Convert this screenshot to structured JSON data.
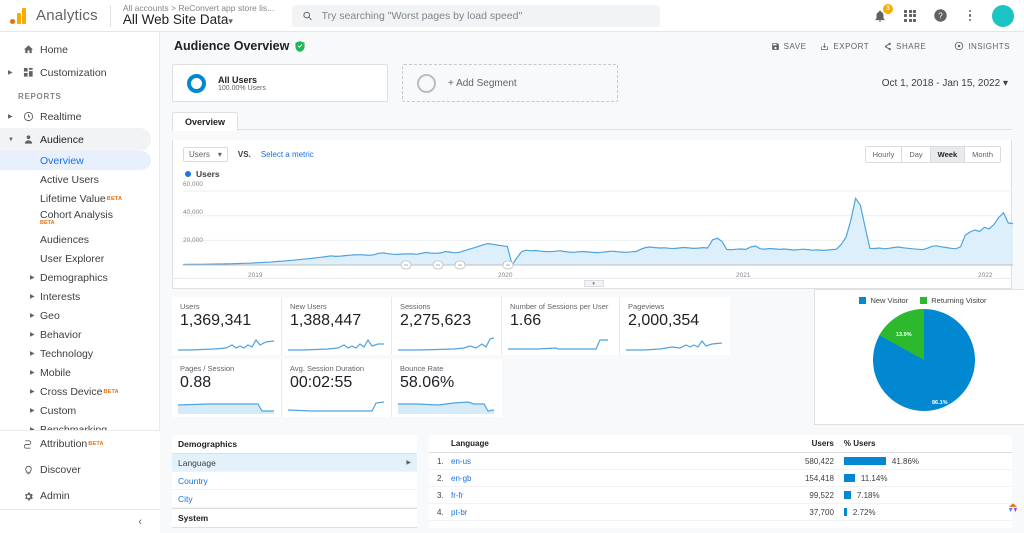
{
  "topbar": {
    "brand": "Analytics",
    "account_crumb": "All accounts > ReConvert app store lis...",
    "property": "All Web Site Data",
    "property_caret": "▾",
    "search_placeholder": "Try searching \"Worst pages by load speed\"",
    "notification_count": "3"
  },
  "sidebar": {
    "home": "Home",
    "customization": "Customization",
    "reports_label": "REPORTS",
    "realtime": "Realtime",
    "audience": "Audience",
    "audience_items": [
      {
        "label": "Overview",
        "selected": true,
        "beta": ""
      },
      {
        "label": "Active Users",
        "selected": false,
        "beta": ""
      },
      {
        "label": "Lifetime Value",
        "selected": false,
        "beta": "BETA"
      },
      {
        "label": "Cohort Analysis",
        "selected": false,
        "beta": "BETA"
      },
      {
        "label": "Audiences",
        "selected": false,
        "beta": ""
      },
      {
        "label": "User Explorer",
        "selected": false,
        "beta": ""
      }
    ],
    "audience_groups": [
      {
        "label": "Demographics",
        "beta": ""
      },
      {
        "label": "Interests",
        "beta": ""
      },
      {
        "label": "Geo",
        "beta": ""
      },
      {
        "label": "Behavior",
        "beta": ""
      },
      {
        "label": "Technology",
        "beta": ""
      },
      {
        "label": "Mobile",
        "beta": ""
      },
      {
        "label": "Cross Device",
        "beta": "BETA"
      },
      {
        "label": "Custom",
        "beta": ""
      },
      {
        "label": "Benchmarking",
        "beta": ""
      }
    ],
    "attribution": "Attribution",
    "attribution_beta": "BETA",
    "discover": "Discover",
    "admin": "Admin",
    "collapse": "‹"
  },
  "header": {
    "title": "Audience Overview",
    "actions": [
      "SAVE",
      "EXPORT",
      "SHARE",
      "INSIGHTS"
    ]
  },
  "segments": {
    "primary_name": "All Users",
    "primary_sub": "100.00% Users",
    "add_label": "+ Add Segment",
    "date_range": "Oct 1, 2018 - Jan 15, 2022",
    "date_caret": "▾"
  },
  "chart_panel": {
    "tab": "Overview",
    "metric": "Users",
    "metric_caret": "▾",
    "vs": "VS.",
    "select_metric": "Select a metric",
    "granularity": [
      {
        "label": "Hourly",
        "on": false
      },
      {
        "label": "Day",
        "on": false
      },
      {
        "label": "Week",
        "on": true
      },
      {
        "label": "Month",
        "on": false
      }
    ],
    "legend": "Users"
  },
  "chart_data": {
    "type": "area",
    "title": "Users",
    "xlabel": "",
    "ylabel": "Users",
    "ylim": [
      0,
      65000
    ],
    "yticks": [
      "20,000",
      "40,000",
      "60,000"
    ],
    "ytick_values": [
      20000,
      40000,
      60000
    ],
    "xticks": [
      "2019",
      "2020",
      "2021",
      "2022"
    ],
    "grid": true,
    "legend_position": "top-left",
    "series": [
      {
        "name": "Users",
        "color": "#4fa3e0",
        "values": [
          400,
          450,
          500,
          520,
          600,
          650,
          700,
          780,
          820,
          900,
          1000,
          1100,
          1200,
          1350,
          1500,
          1700,
          1900,
          2100,
          2300,
          2600,
          2900,
          3200,
          3500,
          3800,
          4200,
          4600,
          5000,
          5400,
          5900,
          6300,
          6800,
          7400,
          7000,
          7200,
          7600,
          8000,
          8200,
          8400,
          8100,
          7900,
          8300,
          9500,
          9800,
          9200,
          8800,
          8600,
          8900,
          9100,
          9000,
          8700,
          9400,
          10200,
          9700,
          9500,
          9800,
          11000,
          10500,
          9900,
          10400,
          11600,
          12800,
          14000,
          15200,
          16500,
          17400,
          16800,
          16200,
          15600,
          15000,
          200,
          5800,
          11000,
          12000,
          11500,
          11800,
          11200,
          11000,
          10800,
          11100,
          11600,
          11000,
          10500,
          10300,
          10800,
          11000,
          10600,
          10200,
          10100,
          10400,
          10900,
          11200,
          10800,
          10500,
          10300,
          10700,
          11000,
          12800,
          14200,
          14600,
          14100,
          13800,
          14000,
          13600,
          13400,
          13800,
          14200,
          13900,
          13500,
          13700,
          14100,
          13800,
          20400,
          21800,
          19200,
          12600,
          12400,
          12800,
          13000,
          12700,
          14600,
          15400,
          13200,
          12900,
          13400,
          13100,
          12700,
          13000,
          12600,
          12200,
          12400,
          12800,
          12500,
          12000,
          12300,
          11900,
          12100,
          12500,
          12800,
          16800,
          22400,
          36200,
          54200,
          48600,
          30800,
          13600,
          13400,
          13800,
          13200,
          13600,
          14200,
          14600,
          14000,
          13600,
          13200,
          12800,
          12400,
          13600,
          15200,
          15600,
          14800,
          14200,
          13600,
          13200,
          14800,
          24200,
          26800,
          28400,
          27200,
          30600,
          29400,
          32800,
          38600,
          42400,
          34200,
          33600
        ]
      }
    ]
  },
  "metric_cards": [
    {
      "label": "Users",
      "value": "1,369,341"
    },
    {
      "label": "New Users",
      "value": "1,388,447"
    },
    {
      "label": "Sessions",
      "value": "2,275,623"
    },
    {
      "label": "Number of Sessions per User",
      "value": "1.66"
    },
    {
      "label": "Pageviews",
      "value": "2,000,354"
    },
    {
      "label": "Pages / Session",
      "value": "0.88"
    },
    {
      "label": "Avg. Session Duration",
      "value": "00:02:55"
    },
    {
      "label": "Bounce Rate",
      "value": "58.06%"
    }
  ],
  "visitor_pie": {
    "type": "pie",
    "title": "",
    "legend_position": "top",
    "labels": [
      "New Visitor",
      "Returning Visitor"
    ],
    "values": [
      86.1,
      13.9
    ],
    "value_labels": [
      "86.1%",
      "13.9%"
    ],
    "colors": [
      "#0288d1",
      "#2db92d"
    ]
  },
  "demographics": {
    "title": "Demographics",
    "items": [
      {
        "label": "Language",
        "selected": true
      },
      {
        "label": "Country",
        "selected": false
      },
      {
        "label": "City",
        "selected": false
      }
    ],
    "system_title": "System"
  },
  "language_table": {
    "columns": [
      "Language",
      "Users",
      "% Users"
    ],
    "rows": [
      {
        "rank": "1.",
        "name": "en-us",
        "users": "580,422",
        "pct": "41.86%",
        "pct_value": 41.86
      },
      {
        "rank": "2.",
        "name": "en-gb",
        "users": "154,418",
        "pct": "11.14%",
        "pct_value": 11.14
      },
      {
        "rank": "3.",
        "name": "fr-fr",
        "users": "99,522",
        "pct": "7.18%",
        "pct_value": 7.18
      },
      {
        "rank": "4.",
        "name": "pt-br",
        "users": "37,700",
        "pct": "2.72%",
        "pct_value": 2.72
      }
    ]
  }
}
